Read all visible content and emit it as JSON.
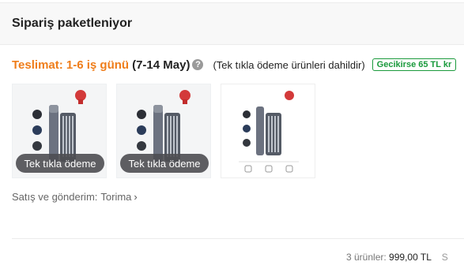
{
  "header": {
    "title": "Sipariş paketleniyor"
  },
  "delivery": {
    "label": "Teslimat: 1-6 iş günü",
    "dates": "(7-14 May)",
    "info_icon": "?",
    "note": "(Tek tıkla ödeme ürünleri dahildir)",
    "late_badge": "Gecikirse 65 TL kr"
  },
  "products": [
    {
      "badge": "Tek tıkla ödeme"
    },
    {
      "badge": "Tek tıkla ödeme"
    },
    {
      "badge": ""
    }
  ],
  "seller": {
    "label": "Satış ve gönderim:",
    "store": "Torima",
    "chevron": "›"
  },
  "summary": {
    "count_label": "3 ürünler:",
    "price": "999,00 TL",
    "cut": "S"
  },
  "colors": {
    "accent": "#ef7d1a",
    "green": "#1a9a3c",
    "pill": "#4e4e52"
  }
}
